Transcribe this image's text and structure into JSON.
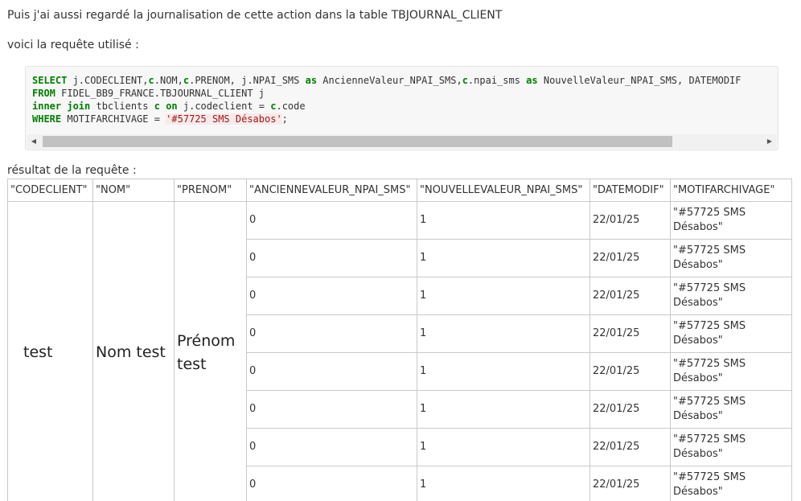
{
  "intro_text": "Puis j'ai aussi regardé la journalisation de cette action dans la table TBJOURNAL_CLIENT",
  "query_label": "voici la requête utilisé :",
  "code": {
    "l1": {
      "kw1": "SELECT",
      "t1": " j.CODECLIENT,",
      "k2": "c",
      "t2": ".NOM,",
      "k3": "c",
      "t3": ".PRENOM, j.NPAI_SMS ",
      "k4": "as",
      "t4": " AncienneValeur_NPAI_SMS,",
      "k5": "c",
      "t5": ".npai_sms ",
      "k6": "as",
      "t6": " NouvelleValeur_NPAI_SMS, DATEMODIF"
    },
    "l2": {
      "kw1": "FROM",
      "t1": " FIDEL_BB9_FRANCE.TBJOURNAL_CLIENT j"
    },
    "l3": {
      "kw1": "inner join",
      "t1": " tbclients ",
      "k2": "c",
      "t2": " ",
      "k3": "on",
      "t3": " j.codeclient = ",
      "k4": "c",
      "t4": ".code"
    },
    "l4": {
      "kw1": "WHERE",
      "t1": " MOTIFARCHIVAGE = ",
      "str": "'#57725 SMS Désabos'",
      "t2": ";"
    }
  },
  "result_label": "résultat de la requête :",
  "table": {
    "headers": [
      "\"CODECLIENT\"",
      "\"NOM\"",
      "\"PRENOM\"",
      "\"ANCIENNEVALEUR_NPAI_SMS\"",
      "\"NOUVELLEVALEUR_NPAI_SMS\"",
      "\"DATEMODIF\"",
      "\"MOTIFARCHIVAGE\""
    ],
    "masked_codeclient": "test",
    "masked_nom": "Nom test",
    "masked_prenom": "Prénom test",
    "rows": [
      {
        "ancienne": "0",
        "nouvelle": "1",
        "datemodif": "22/01/25",
        "motif": "\"#57725 SMS Désabos\""
      },
      {
        "ancienne": "0",
        "nouvelle": "1",
        "datemodif": "22/01/25",
        "motif": "\"#57725 SMS Désabos\""
      },
      {
        "ancienne": "0",
        "nouvelle": "1",
        "datemodif": "22/01/25",
        "motif": "\"#57725 SMS Désabos\""
      },
      {
        "ancienne": "0",
        "nouvelle": "1",
        "datemodif": "22/01/25",
        "motif": "\"#57725 SMS Désabos\""
      },
      {
        "ancienne": "0",
        "nouvelle": "1",
        "datemodif": "22/01/25",
        "motif": "\"#57725 SMS Désabos\""
      },
      {
        "ancienne": "0",
        "nouvelle": "1",
        "datemodif": "22/01/25",
        "motif": "\"#57725 SMS Désabos\""
      },
      {
        "ancienne": "0",
        "nouvelle": "1",
        "datemodif": "22/01/25",
        "motif": "\"#57725 SMS Désabos\""
      },
      {
        "ancienne": "0",
        "nouvelle": "1",
        "datemodif": "22/01/25",
        "motif": "\"#57725 SMS Désabos\""
      }
    ]
  },
  "icons": {
    "scroll_left": "triangle-left",
    "scroll_right": "triangle-right"
  }
}
